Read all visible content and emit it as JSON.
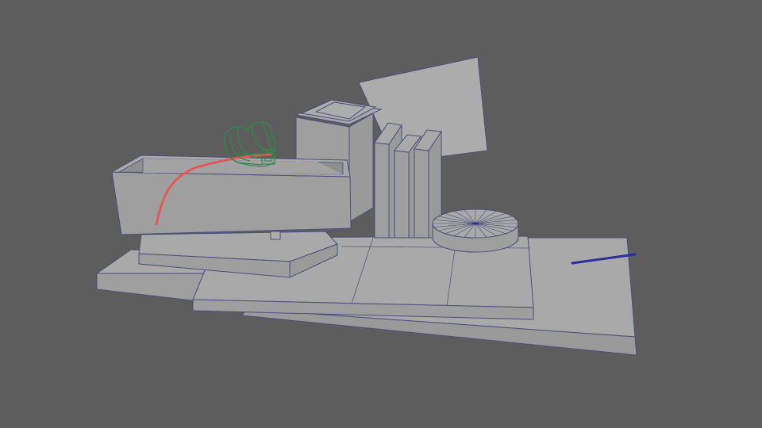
{
  "viewport": {
    "background": "#5d5d5d",
    "model_fill": "#a6a6a6",
    "wire_color": "#4a4f7a"
  },
  "curve": {
    "color": "#e25a5a"
  },
  "locator": {
    "color": "#2e8b45",
    "icon": "camera-control-icon"
  },
  "selected_line": {
    "color": "#2a2f9c"
  }
}
